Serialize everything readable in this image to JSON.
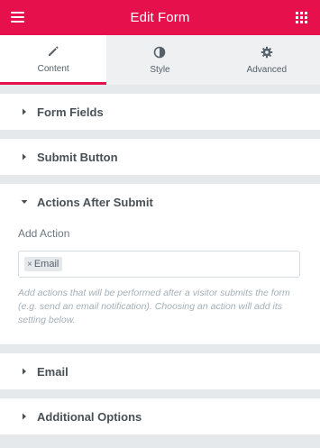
{
  "header": {
    "title": "Edit Form",
    "menu_icon": "hamburger-icon",
    "apps_icon": "apps-grid-icon",
    "background_color": "#e6114c"
  },
  "tabs": [
    {
      "label": "Content",
      "icon": "pencil-icon",
      "active": true
    },
    {
      "label": "Style",
      "icon": "half-circle-icon",
      "active": false
    },
    {
      "label": "Advanced",
      "icon": "gear-icon",
      "active": false
    }
  ],
  "sections": {
    "form_fields": {
      "title": "Form Fields",
      "expanded": false
    },
    "submit_button": {
      "title": "Submit Button",
      "expanded": false
    },
    "actions_after_submit": {
      "title": "Actions After Submit",
      "expanded": true,
      "add_action_label": "Add Action",
      "selected_actions": [
        "Email"
      ],
      "description": "Add actions that will be performed after a visitor submits the form (e.g. send an email notification). Choosing an action will add its setting below."
    },
    "email": {
      "title": "Email",
      "expanded": false
    },
    "additional_options": {
      "title": "Additional Options",
      "expanded": false
    }
  }
}
